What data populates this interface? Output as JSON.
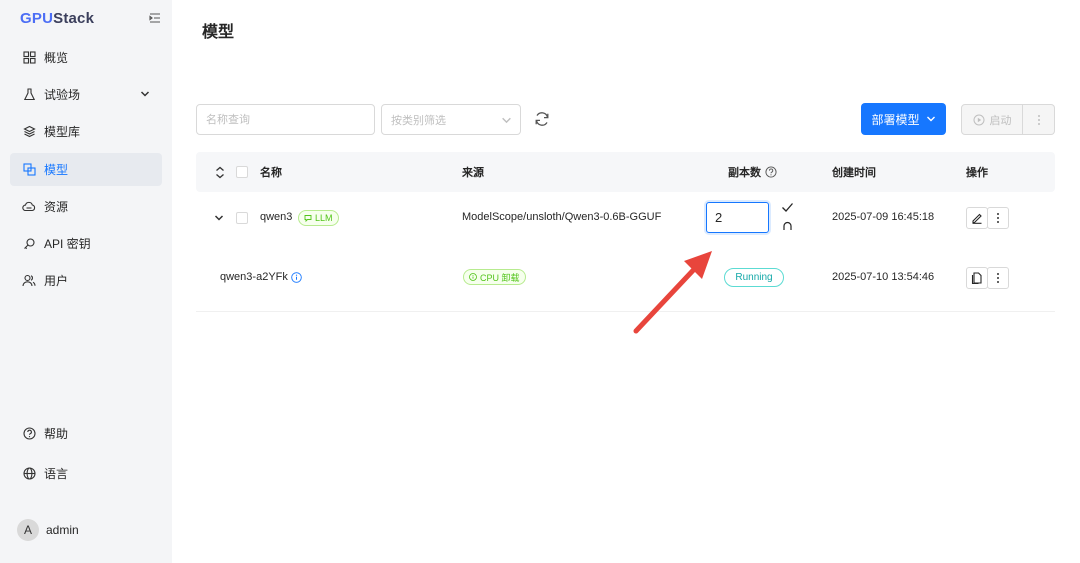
{
  "sidebar": {
    "logo_part1": "GPU",
    "logo_part2": "Stack",
    "items": [
      {
        "label": "概览",
        "icon": "dashboard-icon"
      },
      {
        "label": "试验场",
        "icon": "flask-icon"
      },
      {
        "label": "模型库",
        "icon": "layers-icon"
      },
      {
        "label": "模型",
        "icon": "model-icon",
        "active": true
      },
      {
        "label": "资源",
        "icon": "cloud-icon"
      },
      {
        "label": "API 密钥",
        "icon": "key-icon"
      },
      {
        "label": "用户",
        "icon": "users-icon"
      }
    ],
    "bottom": [
      {
        "label": "帮助",
        "icon": "help-icon"
      },
      {
        "label": "语言",
        "icon": "globe-icon"
      }
    ],
    "user": {
      "initial": "A",
      "name": "admin"
    }
  },
  "page": {
    "title": "模型"
  },
  "toolbar": {
    "search_placeholder": "名称查询",
    "filter_placeholder": "按类别筛选",
    "deploy_label": "部署模型",
    "start_label": "启动"
  },
  "table": {
    "headers": {
      "name": "名称",
      "source": "来源",
      "replicas": "副本数",
      "created": "创建时间",
      "actions": "操作"
    },
    "rows": [
      {
        "name": "qwen3",
        "tag": "LLM",
        "source": "ModelScope/unsloth/Qwen3-0.6B-GGUF",
        "replicas": "2",
        "created": "2025-07-09 16:45:18"
      },
      {
        "name": "qwen3-a2YFk",
        "tag": "CPU 卸载",
        "status": "Running",
        "created": "2025-07-10 13:54:46"
      }
    ]
  },
  "colors": {
    "primary": "#1677ff",
    "sidebar_bg": "#f4f5f7",
    "arrow": "#e8453c",
    "tag_green": "#52c41a",
    "status_cyan": "#13a8a8"
  }
}
